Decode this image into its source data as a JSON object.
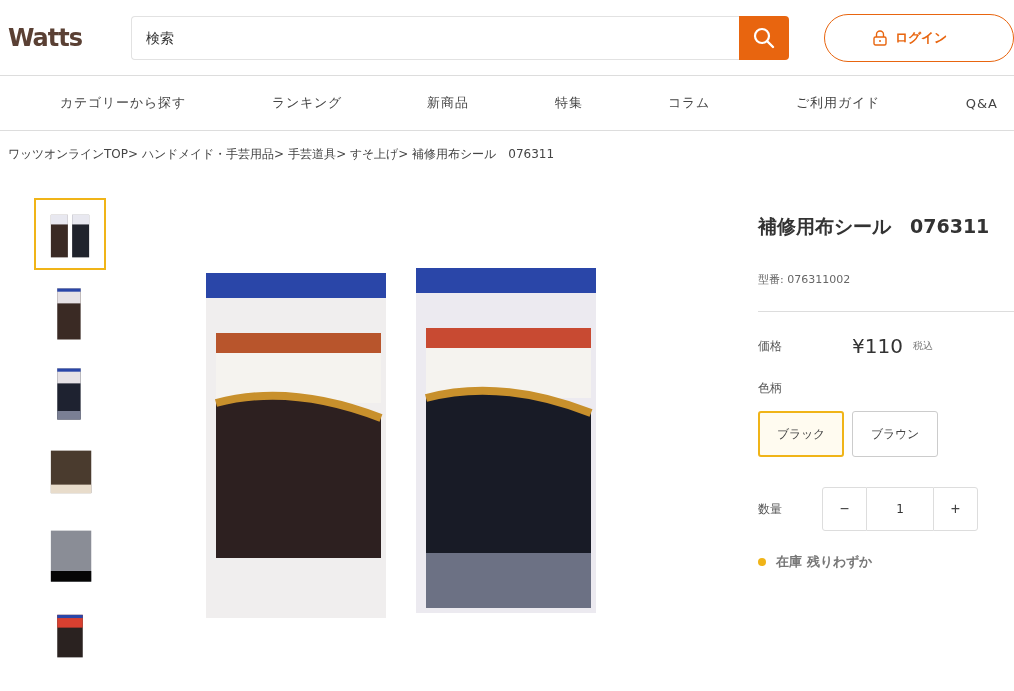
{
  "header": {
    "logo": "Watts",
    "search": {
      "placeholder": "検索"
    },
    "login": "ログイン"
  },
  "nav": [
    "カテゴリーから探す",
    "ランキング",
    "新商品",
    "特集",
    "コラム",
    "ご利用ガイド",
    "Q&A"
  ],
  "breadcrumb": [
    "ワッツオンラインTOP>",
    "ハンドメイド・手芸用品>",
    "手芸道具>",
    "すそ上げ>",
    "補修用布シール　076311"
  ],
  "thumbnails": [
    {
      "kind": "pair",
      "selected": true
    },
    {
      "kind": "brown",
      "selected": false
    },
    {
      "kind": "black",
      "selected": false
    },
    {
      "kind": "brown-swatch",
      "selected": false
    },
    {
      "kind": "gray-swatch",
      "selected": false
    },
    {
      "kind": "pack",
      "selected": false
    }
  ],
  "product": {
    "title": "補修用布シール　076311",
    "model": "型番: 076311002",
    "price_label": "価格",
    "price": "¥110",
    "tax": "税込",
    "color_label": "色柄",
    "colors": [
      {
        "label": "ブラック",
        "selected": true
      },
      {
        "label": "ブラウン",
        "selected": false
      }
    ],
    "qty_label": "数量",
    "qty_minus": "−",
    "qty": "1",
    "qty_plus": "+",
    "stock": "在庫 残りわずか"
  }
}
